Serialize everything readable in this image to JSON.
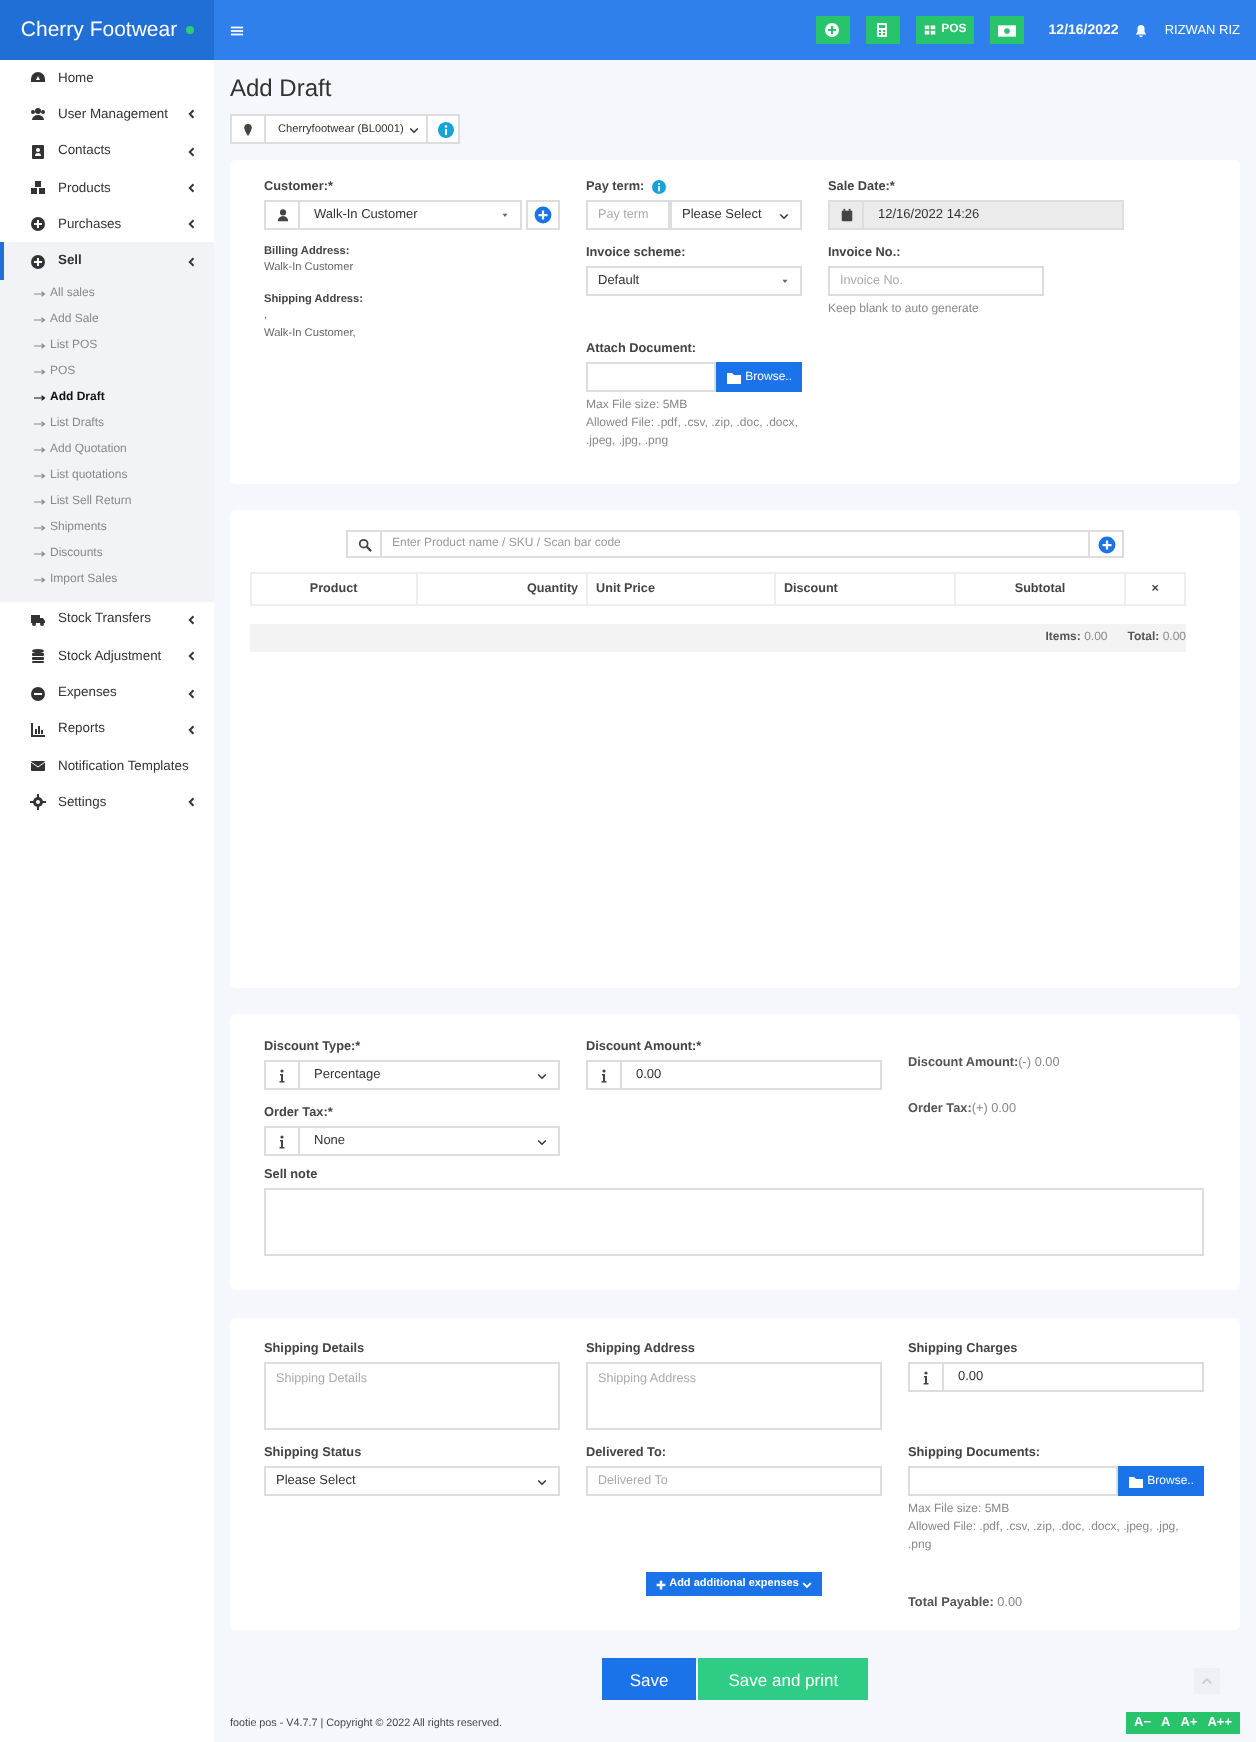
{
  "header": {
    "brand": "Cherry Footwear",
    "online": true,
    "buttons": [
      {
        "kind": "add"
      },
      {
        "kind": "calculator"
      },
      {
        "kind": "pos",
        "label": "POS"
      },
      {
        "kind": "cash"
      }
    ],
    "date": "12/16/2022",
    "user": "RIZWAN RIZ"
  },
  "sidebar": {
    "items": [
      {
        "label": "Home",
        "selected": false,
        "expandable": false
      },
      {
        "label": "User Management",
        "selected": false,
        "expandable": true
      },
      {
        "label": "Contacts",
        "selected": false,
        "expandable": true
      },
      {
        "label": "Products",
        "selected": false,
        "expandable": true
      },
      {
        "label": "Purchases",
        "selected": false,
        "expandable": true
      },
      {
        "label": "Sell",
        "selected": true,
        "expandable": true,
        "children": [
          {
            "label": "All sales",
            "selected": false
          },
          {
            "label": "Add Sale",
            "selected": false
          },
          {
            "label": "List POS",
            "selected": false
          },
          {
            "label": "POS",
            "selected": false
          },
          {
            "label": "Add Draft",
            "selected": true
          },
          {
            "label": "List Drafts",
            "selected": false
          },
          {
            "label": "Add Quotation",
            "selected": false
          },
          {
            "label": "List quotations",
            "selected": false
          },
          {
            "label": "List Sell Return",
            "selected": false
          },
          {
            "label": "Shipments",
            "selected": false
          },
          {
            "label": "Discounts",
            "selected": false
          },
          {
            "label": "Import Sales",
            "selected": false
          }
        ]
      },
      {
        "label": "Stock Transfers",
        "selected": false,
        "expandable": true
      },
      {
        "label": "Stock Adjustment",
        "selected": false,
        "expandable": true
      },
      {
        "label": "Expenses",
        "selected": false,
        "expandable": true
      },
      {
        "label": "Reports",
        "selected": false,
        "expandable": true
      },
      {
        "label": "Notification Templates",
        "selected": false,
        "expandable": false
      },
      {
        "label": "Settings",
        "selected": false,
        "expandable": true
      }
    ]
  },
  "page": {
    "title": "Add Draft",
    "location": "Cherryfootwear (BL0001)"
  },
  "details": {
    "customer": {
      "label": "Customer:*",
      "value": "Walk-In Customer"
    },
    "billing_address": {
      "label": "Billing Address:",
      "lines": [
        "Walk-In Customer"
      ]
    },
    "shipping_address": {
      "label": "Shipping Address:",
      "lines": [
        ",",
        "Walk-In Customer,"
      ]
    },
    "pay_term": {
      "label": "Pay term:",
      "placeholder": "Pay term",
      "value": "Please Select"
    },
    "sale_date": {
      "label": "Sale Date:*",
      "value": "12/16/2022 14:26"
    },
    "invoice_scheme": {
      "label": "Invoice scheme:",
      "value": "Default"
    },
    "invoice_no": {
      "label": "Invoice No.:",
      "placeholder": "Invoice No.",
      "help": "Keep blank to auto generate"
    },
    "attach_document": {
      "label": "Attach Document:",
      "button": "Browse..",
      "help": [
        "Max File size: 5MB",
        "Allowed File: .pdf, .csv, .zip, .doc, .docx, .jpeg, .jpg, .png"
      ]
    }
  },
  "products": {
    "search_placeholder": "Enter Product name / SKU / Scan bar code",
    "columns": [
      "Product",
      "Quantity",
      "Unit Price",
      "Discount",
      "Subtotal",
      "×"
    ],
    "items_label": "Items:",
    "items_value": "0.00",
    "total_label": "Total:",
    "total_value": "0.00"
  },
  "summary": {
    "discount_type": {
      "label": "Discount Type:*",
      "value": "Percentage"
    },
    "discount_amount": {
      "label": "Discount Amount:*",
      "value": "0.00"
    },
    "discount_total": {
      "label": "Discount Amount:",
      "value": "(-) 0.00"
    },
    "order_tax": {
      "label": "Order Tax:*",
      "value": "None"
    },
    "order_tax_total": {
      "label": "Order Tax:",
      "value": "(+) 0.00"
    },
    "sell_note": {
      "label": "Sell note"
    }
  },
  "shipping": {
    "details": {
      "label": "Shipping Details",
      "placeholder": "Shipping Details"
    },
    "address": {
      "label": "Shipping Address",
      "placeholder": "Shipping Address"
    },
    "charges": {
      "label": "Shipping Charges",
      "value": "0.00"
    },
    "status": {
      "label": "Shipping Status",
      "value": "Please Select"
    },
    "delivered_to": {
      "label": "Delivered To:",
      "placeholder": "Delivered To"
    },
    "documents": {
      "label": "Shipping Documents:",
      "button": "Browse..",
      "help": [
        "Max File size: 5MB",
        "Allowed File: .pdf, .csv, .zip, .doc, .docx, .jpeg, .jpg, .png"
      ]
    },
    "add_expenses": "Add additional expenses",
    "total_payable": {
      "label": "Total Payable:",
      "value": "0.00"
    }
  },
  "actions": [
    {
      "label": "Save",
      "kind": "primary"
    },
    {
      "label": "Save and print",
      "kind": "success"
    }
  ],
  "footer": {
    "text": "footie pos - V4.7.7 | Copyright © 2022 All rights reserved.",
    "font_buttons": [
      "A−",
      "A",
      "A+",
      "A++"
    ]
  }
}
